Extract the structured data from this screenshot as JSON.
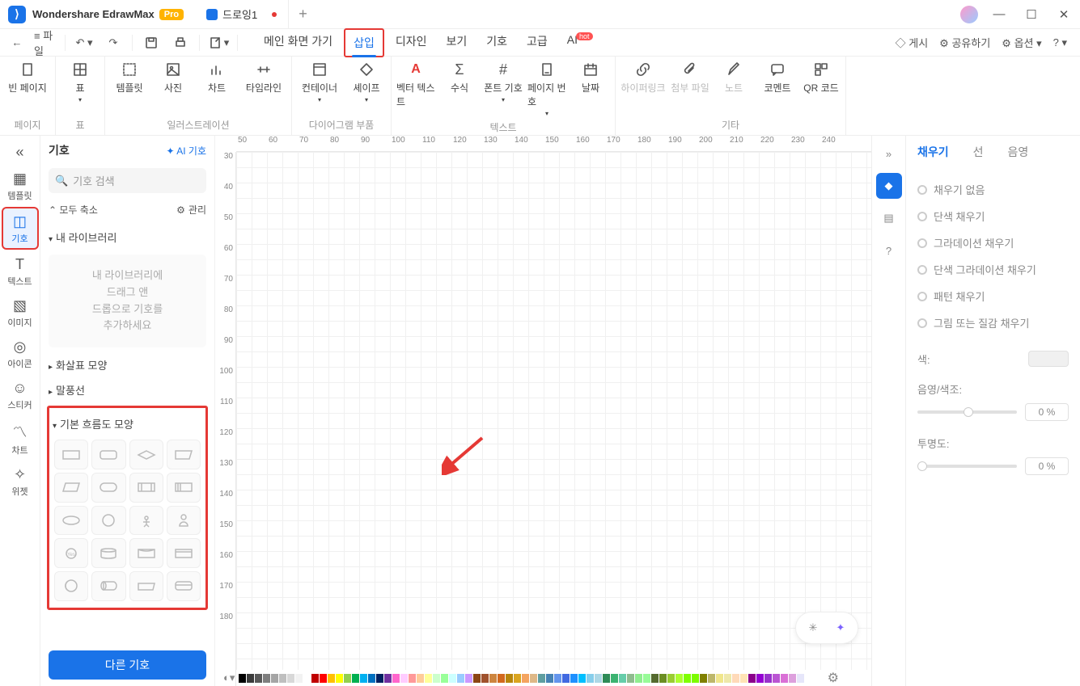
{
  "app": {
    "name": "Wondershare EdrawMax",
    "badge": "Pro",
    "tab_name": "드로잉1"
  },
  "menubar": {
    "back": "←",
    "fwd": "→",
    "menu": "≡ 파일",
    "tabs": [
      "메인 화면 가기",
      "삽입",
      "디자인",
      "보기",
      "기호",
      "고급",
      "AI"
    ],
    "active": "삽입",
    "hot": "hot",
    "right": [
      "게시",
      "공유하기",
      "옵션"
    ]
  },
  "ribbon": {
    "g_page": "페이지",
    "g_table": "표",
    "g_illust": "일러스트레이션",
    "g_diagram": "다이어그램 부품",
    "g_text": "텍스트",
    "g_etc": "기타",
    "blank_page": "빈 페이지",
    "table": "표",
    "template": "템플릿",
    "picture": "사진",
    "chart": "차트",
    "timeline": "타임라인",
    "container": "컨테이너",
    "shape": "셰이프",
    "vector_text": "벡터 텍스트",
    "font_symbol": "폰트 기호",
    "formula": "수식",
    "page_no": "페이지 번호",
    "date": "날짜",
    "hyperlink": "하이퍼링크",
    "attach": "첨부 파일",
    "note": "노트",
    "comment": "코멘트",
    "qr": "QR 코드"
  },
  "leftrail": {
    "collapse": "«",
    "template": "템플릿",
    "symbol": "기호",
    "text": "텍스트",
    "image": "이미지",
    "icon": "아이콘",
    "sticker": "스티커",
    "chart": "차트",
    "widget": "위젯"
  },
  "sympanel": {
    "title": "기호",
    "ai": "AI 기호",
    "search": "기호 검색",
    "collapse": "모두 축소",
    "manage": "관리",
    "mylib": "내 라이브러리",
    "dropmsg": "내 라이브러리에\n드래그 앤\n드롭으로 기호를\n추가하세요",
    "arrow": "화살표 모양",
    "callout": "말풍선",
    "flow": "기본 흐름도 모양",
    "more": "다른 기호"
  },
  "ruler_h": [
    "50",
    "60",
    "70",
    "80",
    "90",
    "100",
    "110",
    "120",
    "130",
    "140",
    "150",
    "160",
    "170",
    "180",
    "190",
    "200",
    "210",
    "220",
    "230",
    "240"
  ],
  "ruler_v": [
    "30",
    "40",
    "50",
    "60",
    "70",
    "80",
    "90",
    "100",
    "110",
    "120",
    "130",
    "140",
    "150",
    "160",
    "170",
    "180"
  ],
  "rightpanel": {
    "fill": "채우기",
    "line": "선",
    "shadow": "음영",
    "none": "채우기 없음",
    "solid": "단색 채우기",
    "grad": "그라데이션 채우기",
    "solidgrad": "단색 그라데이션 채우기",
    "pattern": "패턴 채우기",
    "picture": "그림 또는 질감 채우기",
    "color": "색:",
    "tint": "음영/색조:",
    "opacity": "투명도:",
    "tint_val": "0 %",
    "opacity_val": "0 %"
  },
  "colors": [
    "#000",
    "#3b3b3b",
    "#595959",
    "#7f7f7f",
    "#a5a5a5",
    "#bfbfbf",
    "#d8d8d8",
    "#f2f2f2",
    "#fff",
    "#c00000",
    "#ff0000",
    "#ffc000",
    "#ffff00",
    "#92d050",
    "#00b050",
    "#00b0f0",
    "#0070c0",
    "#002060",
    "#7030a0",
    "#ff66cc",
    "#ffccff",
    "#ff9999",
    "#ffcc99",
    "#ffff99",
    "#ccffcc",
    "#99ff99",
    "#ccffff",
    "#99ccff",
    "#cc99ff",
    "#8b4513",
    "#a0522d",
    "#cd853f",
    "#d2691e",
    "#b8860b",
    "#daa520",
    "#f4a460",
    "#deb887",
    "#5f9ea0",
    "#4682b4",
    "#6495ed",
    "#4169e1",
    "#1e90ff",
    "#00bfff",
    "#87ceeb",
    "#add8e6",
    "#2e8b57",
    "#3cb371",
    "#66cdaa",
    "#8fbc8f",
    "#90ee90",
    "#98fb98",
    "#556b2f",
    "#6b8e23",
    "#9acd32",
    "#adff2f",
    "#7fff00",
    "#7cfc00",
    "#808000",
    "#bdb76b",
    "#f0e68c",
    "#eee8aa",
    "#ffdab9",
    "#ffe4b5",
    "#8b008b",
    "#9400d3",
    "#9932cc",
    "#ba55d3",
    "#da70d6",
    "#dda0dd",
    "#e6e6fa"
  ]
}
